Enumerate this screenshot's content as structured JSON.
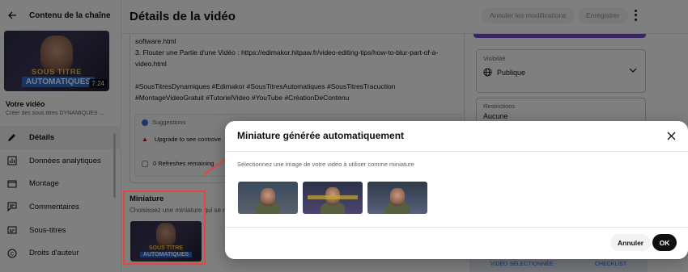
{
  "sidebar": {
    "header_title": "Contenu de la chaîne",
    "thumbnail": {
      "line1": "SOUS TITRE",
      "line2": "AUTOMATIQUES",
      "duration": "7:24"
    },
    "video_label": "Votre vidéo",
    "video_subtitle": "Créer des sous titres DYNAMIQUES ...",
    "items": [
      {
        "label": "Détails",
        "icon": "pencil-icon"
      },
      {
        "label": "Données analytiques",
        "icon": "analytics-icon"
      },
      {
        "label": "Montage",
        "icon": "editor-icon"
      },
      {
        "label": "Commentaires",
        "icon": "comments-icon"
      },
      {
        "label": "Sous-titres",
        "icon": "subtitles-icon"
      },
      {
        "label": "Droits d'auteur",
        "icon": "copyright-icon"
      }
    ]
  },
  "topbar": {
    "title": "Détails de la vidéo",
    "undo_label": "Annuler les modifications",
    "save_label": "Enregistrer"
  },
  "description": {
    "lines": [
      "software.html",
      "3. Flouter une Partie d'une Vidéo : https://edimakor.hitpaw.fr/video-editing-tips/how-to-blur-part-of-a-",
      "video.html",
      "",
      "#SousTitresDynamiques #Edimakor #SousTitresAutomatiques #SousTitresTracuction",
      "#MontageVideoGratuit #TutorielVideo #YouTube #CréationDeContenu"
    ]
  },
  "suggestions": {
    "title": "Suggestions",
    "row1": "Upgrade to see controve",
    "row2": "0 Refreshes remaining"
  },
  "miniature": {
    "title": "Miniature",
    "desc": "Choisissez une miniature qui se rem",
    "thumb_line1": "SOUS TITRE",
    "thumb_line2": "AUTOMATIQUES"
  },
  "right_panel": {
    "visibility_label": "Visibilité",
    "visibility_value": "Publique",
    "restrictions_label": "Restrictions",
    "restrictions_value": "Aucune",
    "tab1": "VIDÉO SÉLECTIONNÉE",
    "tab2": "CHECKLIST"
  },
  "dialog": {
    "title": "Miniature générée automatiquement",
    "instruction": "Sélectionnez une image de votre vidéo à utiliser comme miniature",
    "cancel_label": "Annuler",
    "ok_label": "OK"
  },
  "colors": {
    "highlight_red": "#e8453c",
    "accent_purple": "#6c4ec7",
    "ok_button": "#0f0f0f"
  }
}
